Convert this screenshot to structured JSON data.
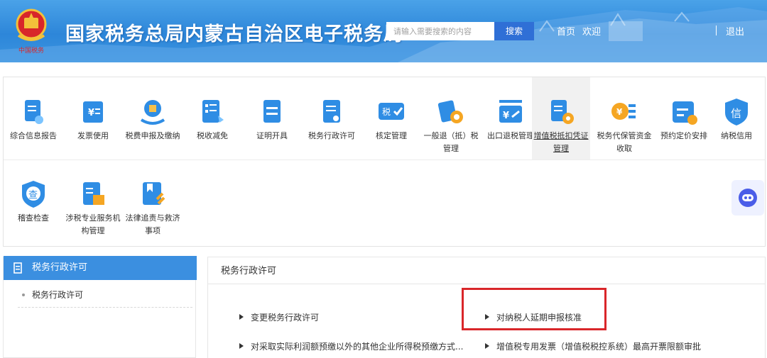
{
  "header": {
    "site_title": "国家税务总局内蒙古自治区电子税务局",
    "search_placeholder": "请输入需要搜索的内容",
    "search_button": "搜索",
    "home_link": "首页",
    "welcome": "欢迎",
    "logout": "退出",
    "emblem_icon": "tax-emblem-icon"
  },
  "functions": [
    {
      "label": "综合信息报告",
      "icon": "report-icon",
      "color": "#2f8de4"
    },
    {
      "label": "发票使用",
      "icon": "invoice-icon",
      "color": "#2f8de4"
    },
    {
      "label": "税费申报及缴纳",
      "icon": "tax-declare-icon",
      "color": "#2f8de4"
    },
    {
      "label": "税收减免",
      "icon": "tax-relief-icon",
      "color": "#2f8de4"
    },
    {
      "label": "证明开具",
      "icon": "certificate-icon",
      "color": "#2f8de4"
    },
    {
      "label": "税务行政许可",
      "icon": "permit-icon",
      "color": "#2f8de4"
    },
    {
      "label": "核定管理",
      "icon": "assess-icon",
      "color": "#2f8de4"
    },
    {
      "label": "一般退（抵）税管理",
      "icon": "refund-icon",
      "color": "#2f8de4"
    },
    {
      "label": "出口退税管理",
      "icon": "export-refund-icon",
      "color": "#2f8de4"
    },
    {
      "label": "增值税抵扣凭证管理",
      "icon": "vat-deduct-icon",
      "color": "#2f8de4",
      "active": true
    },
    {
      "label": "税务代保管资金收取",
      "icon": "custody-fund-icon",
      "color": "#2f8de4"
    },
    {
      "label": "预约定价安排",
      "icon": "pricing-icon",
      "color": "#2f8de4"
    },
    {
      "label": "纳税信用",
      "icon": "credit-icon",
      "color": "#2f8de4"
    },
    {
      "label": "稽查检查",
      "icon": "inspection-icon",
      "color": "#2f8de4"
    },
    {
      "label": "涉税专业服务机构管理",
      "icon": "agency-icon",
      "color": "#2f8de4"
    },
    {
      "label": "法律追责与救济事项",
      "icon": "legal-icon",
      "color": "#2f8de4"
    }
  ],
  "sidebar": {
    "header": "税务行政许可",
    "items": [
      "税务行政许可"
    ]
  },
  "main": {
    "title": "税务行政许可",
    "items": [
      "变更税务行政许可",
      "对纳税人延期申报核准",
      "对采取实际利润额预缴以外的其他企业所得税预缴方式...",
      "增值税专用发票（增值税税控系统）最高开票限额审批"
    ]
  },
  "assistant_icon": "robot-assistant-icon",
  "colors": {
    "brand": "#2d86d9",
    "accent": "#3b8fe0",
    "highlight": "#d9262a"
  }
}
